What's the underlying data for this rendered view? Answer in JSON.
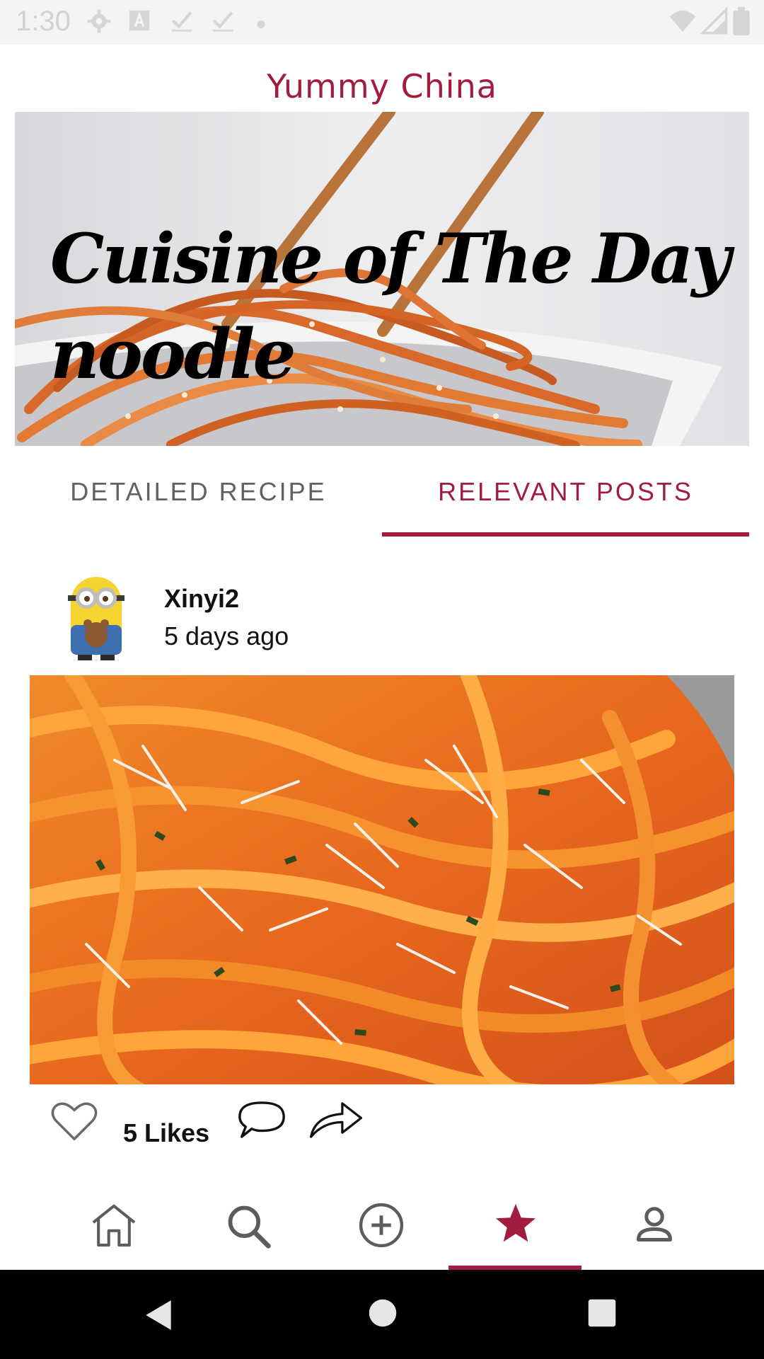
{
  "status_bar": {
    "time": "1:30",
    "left_icons": [
      "gear-icon",
      "text-a-icon",
      "checkmark-icon",
      "checkmark-icon",
      "dot-icon"
    ],
    "right_icons": [
      "wifi-icon",
      "signal-icon",
      "battery-icon"
    ]
  },
  "app": {
    "title": "Yummy China",
    "accent": "#a11c3e"
  },
  "hero": {
    "line1": "Cuisine of The Day",
    "line2": "noodle"
  },
  "tabs": [
    {
      "label": "DETAILED RECIPE",
      "selected": false
    },
    {
      "label": "RELEVANT POSTS",
      "selected": true
    }
  ],
  "post": {
    "username": "Xinyi2",
    "time_ago": "5 days ago",
    "likes_label": "5 Likes"
  },
  "bottom_nav": [
    {
      "icon": "home-icon",
      "selected": false
    },
    {
      "icon": "search-icon",
      "selected": false
    },
    {
      "icon": "add-circle-icon",
      "selected": false
    },
    {
      "icon": "star-icon",
      "selected": true
    },
    {
      "icon": "profile-icon",
      "selected": false
    }
  ],
  "system_nav": [
    "back-icon",
    "home-circle-icon",
    "recents-icon"
  ]
}
